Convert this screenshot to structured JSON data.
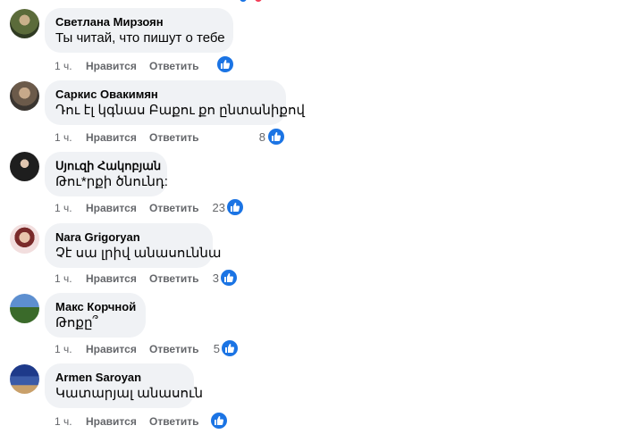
{
  "comments": [
    {
      "author": "Светлана Мирзоян",
      "text": "Ты читай, что пишут о тебе",
      "time": "1 ч.",
      "like": "Нравится",
      "reply": "Ответить",
      "reactions": ""
    },
    {
      "author": "Саркис Овакимян",
      "text": "Դու էլ կգնաս Բաքու քո ընտանիքով",
      "time": "1 ч.",
      "like": "Нравится",
      "reply": "Ответить",
      "reactions": "8"
    },
    {
      "author": "Սյուզի Հակոբյան",
      "text": "Թու*րքի ծնունդ:",
      "time": "1 ч.",
      "like": "Нравится",
      "reply": "Ответить",
      "reactions": "23"
    },
    {
      "author": "Nara Grigoryan",
      "text": "Չէ սա լրիվ անասուննա",
      "time": "1 ч.",
      "like": "Нравится",
      "reply": "Ответить",
      "reactions": "3"
    },
    {
      "author": "Макс Корчной",
      "text": "Թոքը՞",
      "time": "1 ч.",
      "like": "Нравится",
      "reply": "Ответить",
      "reactions": "5"
    },
    {
      "author": "Armen Saroyan",
      "text": "Կատարյալ անասուն",
      "time": "1 ч.",
      "like": "Нравится",
      "reply": "Ответить",
      "reactions": ""
    }
  ],
  "colors": {
    "bubble": "#f0f2f5",
    "like_blue": "#1b74e4",
    "meta_gray": "#65676b"
  }
}
